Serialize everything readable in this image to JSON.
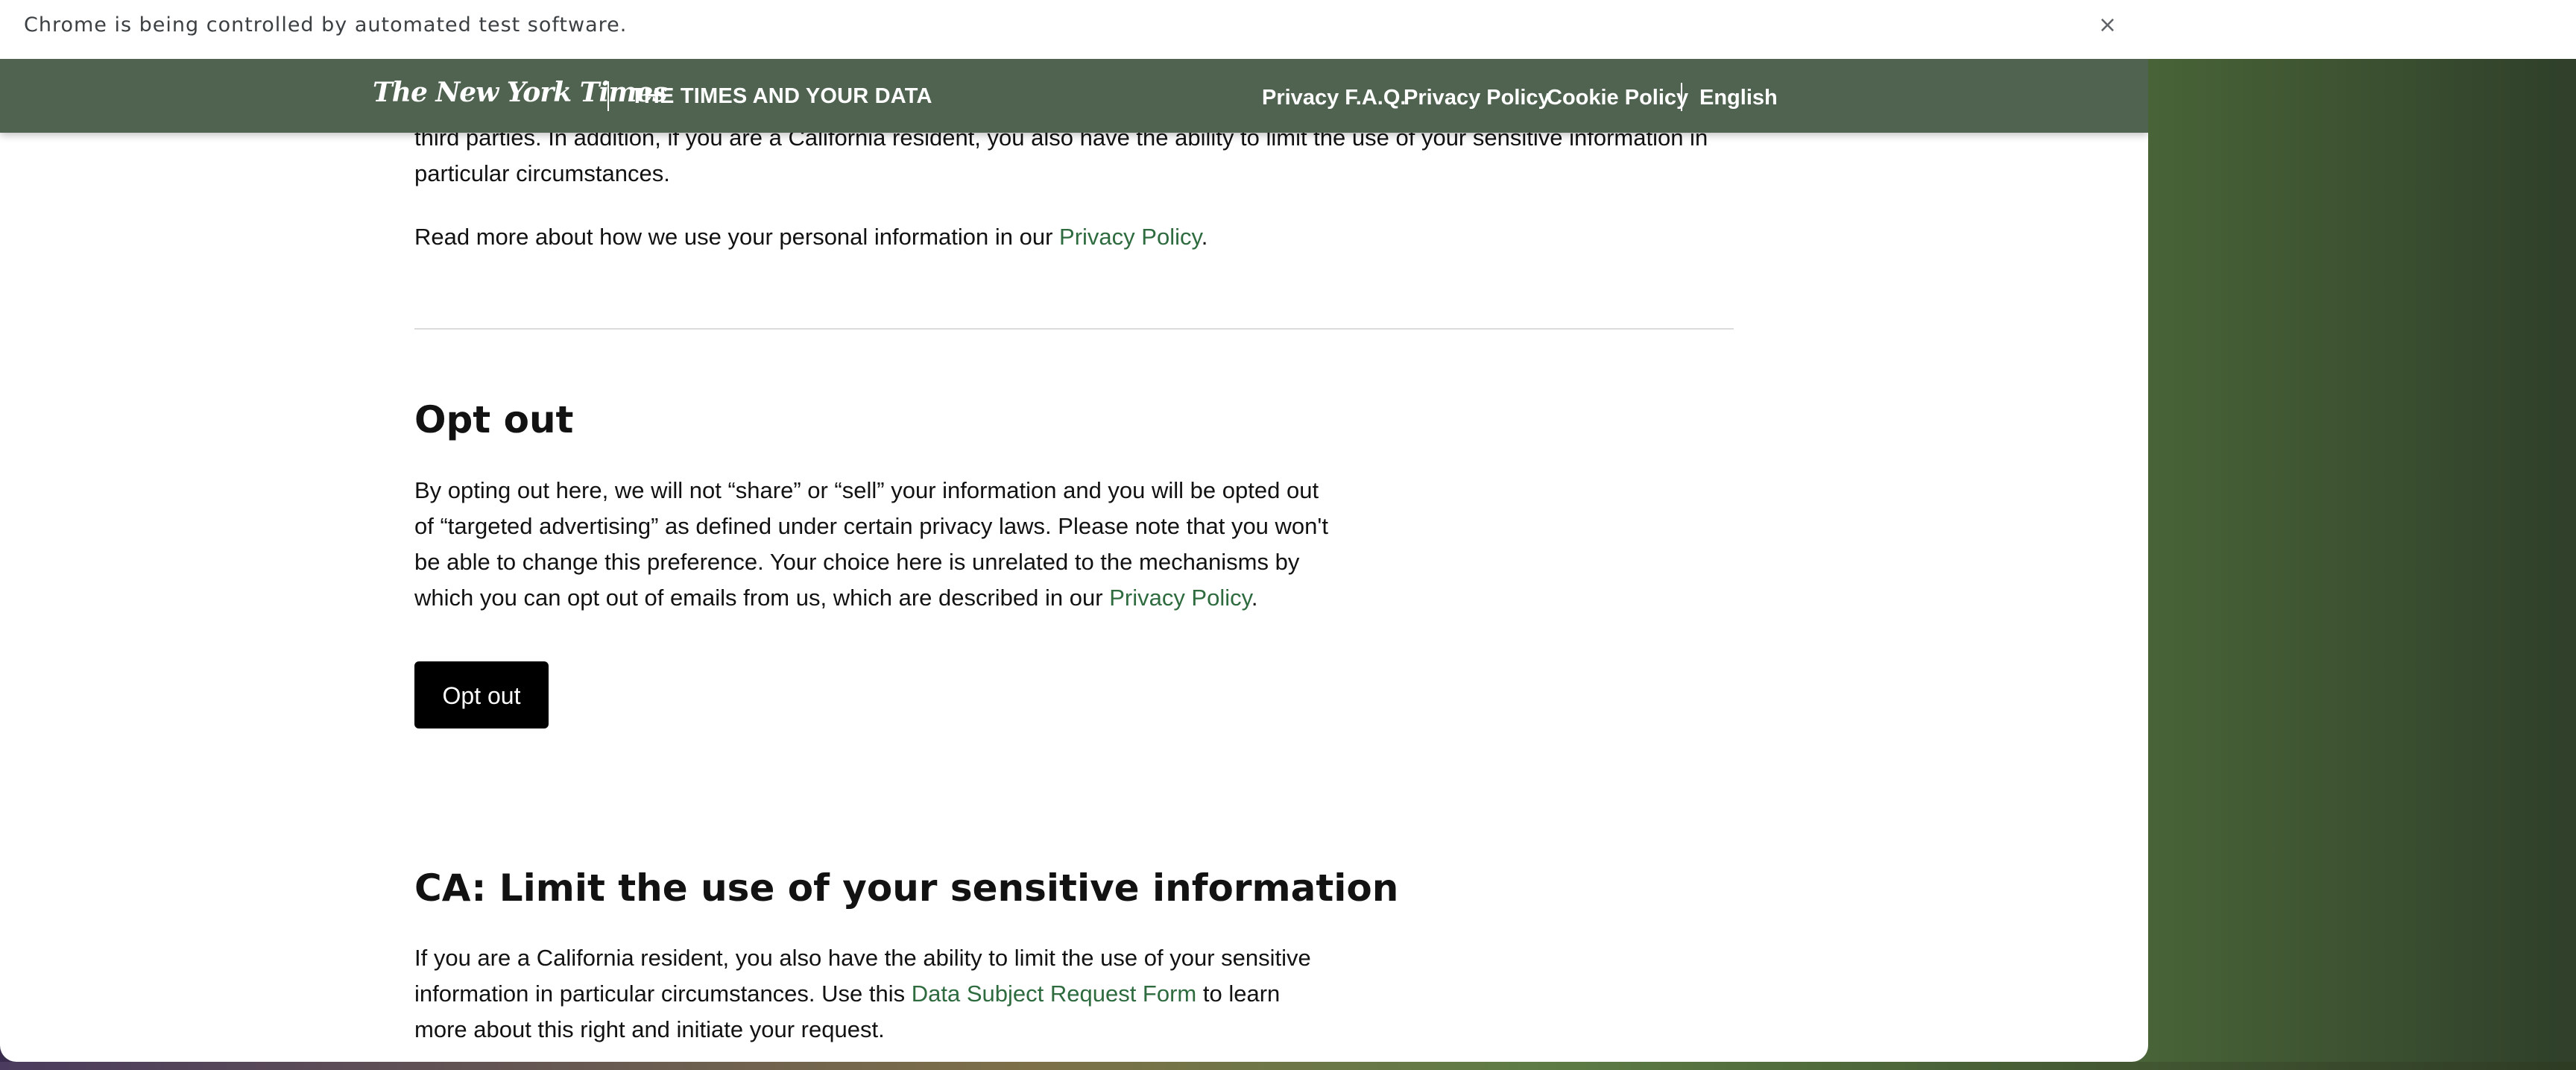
{
  "browser": {
    "automation_notice": "Chrome is being controlled by automated test software.",
    "close_glyph": "×"
  },
  "header": {
    "logo_text": "The New York Times",
    "section_title": "The Times and Your Data",
    "nav": [
      {
        "label": "Privacy F.A.Q."
      },
      {
        "label": "Privacy Policy"
      },
      {
        "label": "Cookie Policy"
      },
      {
        "label": "English"
      }
    ],
    "background_color": "#506351"
  },
  "content": {
    "top_paragraph": {
      "line1": "third parties. In addition, if you are a California resident, you also have the ability to limit the use of your sensitive information in",
      "line2": "particular circumstances."
    },
    "read_more": {
      "text_before": "Read more about how we use your personal information in our ",
      "link": "Privacy Policy",
      "text_after": "."
    },
    "opt_out_section": {
      "heading": "Opt out",
      "lines": [
        "By opting out here, we will not “share” or “sell” your information and you will be opted out",
        "of “targeted advertising” as defined under certain privacy laws. Please note that you won't",
        "be able to change this preference. Your choice here is unrelated to the mechanisms by",
        "which you can opt out of emails from us, which are described in our "
      ],
      "link": "Privacy Policy",
      "text_after": ".",
      "button_label": "Opt out"
    },
    "ca_section": {
      "heading": "CA: Limit the use of your sensitive information",
      "line1": "If you are a California resident, you also have the ability to limit the use of your sensitive",
      "line2_before": "information in particular circumstances. Use this ",
      "line2_link": "Data Subject Request Form",
      "line2_after": " to learn",
      "line3": "more about this right and initiate your request."
    },
    "link_color": "#2e6b3f"
  }
}
